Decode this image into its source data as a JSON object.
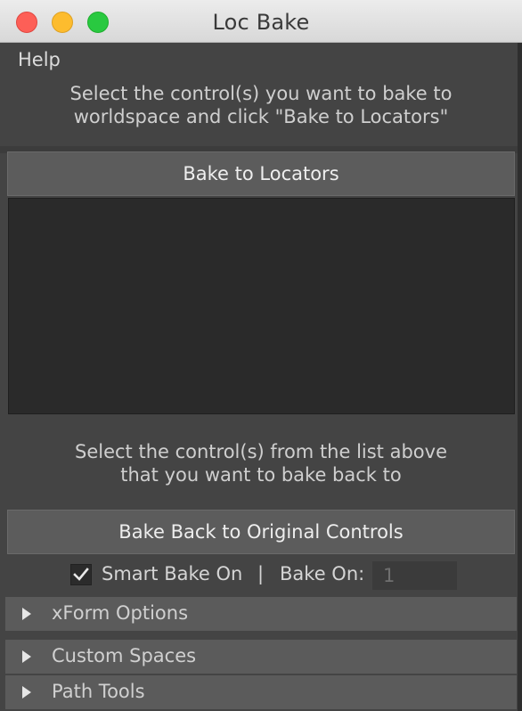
{
  "window": {
    "title": "Loc Bake",
    "buttons": [
      "close",
      "minimize",
      "maximize"
    ]
  },
  "menu": {
    "help": "Help"
  },
  "instructions": {
    "top_line1": "Select the control(s) you want to bake to",
    "top_line2": "worldspace and click \"Bake to Locators\"",
    "bottom_line1": "Select the control(s) from the list above",
    "bottom_line2": "that you want to bake back to"
  },
  "buttons": {
    "bake_to_locators": "Bake to Locators",
    "bake_back": "Bake Back to Original Controls"
  },
  "options": {
    "smart_bake_label": "Smart Bake On",
    "smart_bake_checked": true,
    "separator": "|",
    "bake_on_label": "Bake On:",
    "bake_on_value": "1"
  },
  "sections": [
    {
      "label": "xForm Options",
      "expanded": false
    },
    {
      "label": "Custom Spaces",
      "expanded": false
    },
    {
      "label": "Path Tools",
      "expanded": false
    }
  ],
  "colors": {
    "close": "#fd5f57",
    "minimize": "#fdbc2e",
    "maximize": "#29c940",
    "panel": "#444444",
    "list_bg": "#2a2a2a",
    "button": "#5c5c5c"
  }
}
